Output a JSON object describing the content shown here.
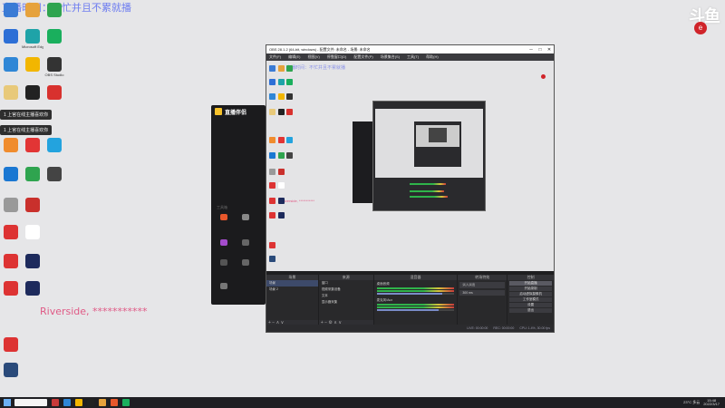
{
  "overlay": {
    "top_text": "直播时间：不忙并且不累就播",
    "riverside_text": "Riverside, ***********",
    "douyu_logo": "斗鱼",
    "douyu_badge": "e"
  },
  "desktop": {
    "icons": [
      {
        "label": "",
        "color": "#3a7bd5"
      },
      {
        "label": "",
        "color": "#e6a23c"
      },
      {
        "label": "",
        "color": "#2fa44f"
      },
      {
        "label": "",
        "color": "#2d6fd6"
      },
      {
        "label": "Microsoft Edge",
        "color": "#1fa3a8"
      },
      {
        "label": "",
        "color": "#1aaf5d"
      },
      {
        "label": "",
        "color": "#2f86d6"
      },
      {
        "label": "",
        "color": "#f2b600"
      },
      {
        "label": "OBS Studio",
        "color": "#333"
      },
      {
        "label": "",
        "color": "#e8c97a"
      },
      {
        "label": "",
        "color": "#222"
      },
      {
        "label": "",
        "color": "#d8312e"
      },
      {
        "label": "",
        "color": "#f08c2e"
      },
      {
        "label": "",
        "color": "#e23535"
      },
      {
        "label": "",
        "color": "#23a3de"
      },
      {
        "label": "",
        "color": "#1a77d2"
      },
      {
        "label": "",
        "color": "#2fa44f"
      },
      {
        "label": "",
        "color": "#444"
      },
      {
        "label": "",
        "color": "#999"
      },
      {
        "label": "",
        "color": "#c9302c"
      },
      {
        "label": "",
        "color": "#d33"
      },
      {
        "label": "",
        "color": "#fff"
      },
      {
        "label": "",
        "color": "#d33"
      },
      {
        "label": "",
        "color": "#1d2a5c"
      },
      {
        "label": "",
        "color": "#d33"
      },
      {
        "label": "",
        "color": "#1d2a5c"
      },
      {
        "label": "",
        "color": "#d33"
      },
      {
        "label": "",
        "color": "#2a4a7a"
      }
    ],
    "notifications": [
      "1 上官在线主播喜欢你",
      "1 上官在线主播喜欢你"
    ]
  },
  "companion": {
    "title": "直播伴侣",
    "tabs": [
      "",
      "",
      ""
    ],
    "section_label": "工具箱",
    "tools": [
      {
        "label": "",
        "color": "#e8572b"
      },
      {
        "label": "",
        "color": "#888"
      },
      {
        "label": "",
        "color": "#a44ccc"
      },
      {
        "label": "",
        "color": "#666"
      },
      {
        "label": "",
        "color": "#555"
      },
      {
        "label": "",
        "color": "#666"
      },
      {
        "label": "",
        "color": "#777"
      }
    ],
    "footer": ""
  },
  "obs": {
    "title": "OBS 28.1.2 (64-bit, windows) - 配置文件: 未命名 - 场景: 未命名",
    "menu": [
      "文件(F)",
      "编辑(E)",
      "视图(V)",
      "停靠窗口(D)",
      "配置文件(P)",
      "场景集合(S)",
      "工具(T)",
      "帮助(H)"
    ],
    "scenes_header": "场景",
    "scenes": [
      "场景",
      "场景 2"
    ],
    "sources_header": "来源",
    "sources": [
      "窗口",
      "视频采集设备",
      "文本",
      "显示器采集"
    ],
    "mixer_header": "混音器",
    "mixer_channels": [
      {
        "name": "桌面音频",
        "level": 0.85
      },
      {
        "name": "麦克风/Aux",
        "level": 0.8
      }
    ],
    "transitions_header": "转场特效",
    "transition_name": "淡入淡出",
    "transition_duration": "300 ms",
    "controls_header": "控制",
    "controls": [
      "开始直播",
      "开始录制",
      "启动虚拟摄像机",
      "工作室模式",
      "设置",
      "退出"
    ],
    "status": {
      "live": "LIVE: 00:00:00",
      "rec": "REC: 00:00:00",
      "cpu": "CPU: 1.4%, 30.00 fps"
    }
  },
  "taskbar": {
    "apps": [
      "#c83a3a",
      "#2f86d6",
      "#f2b600",
      "#222",
      "#e6a23c",
      "#e8572b",
      "#1aaf5d"
    ],
    "weather": "23°C 多云",
    "time": "15:48",
    "date": "2022/3/17"
  }
}
